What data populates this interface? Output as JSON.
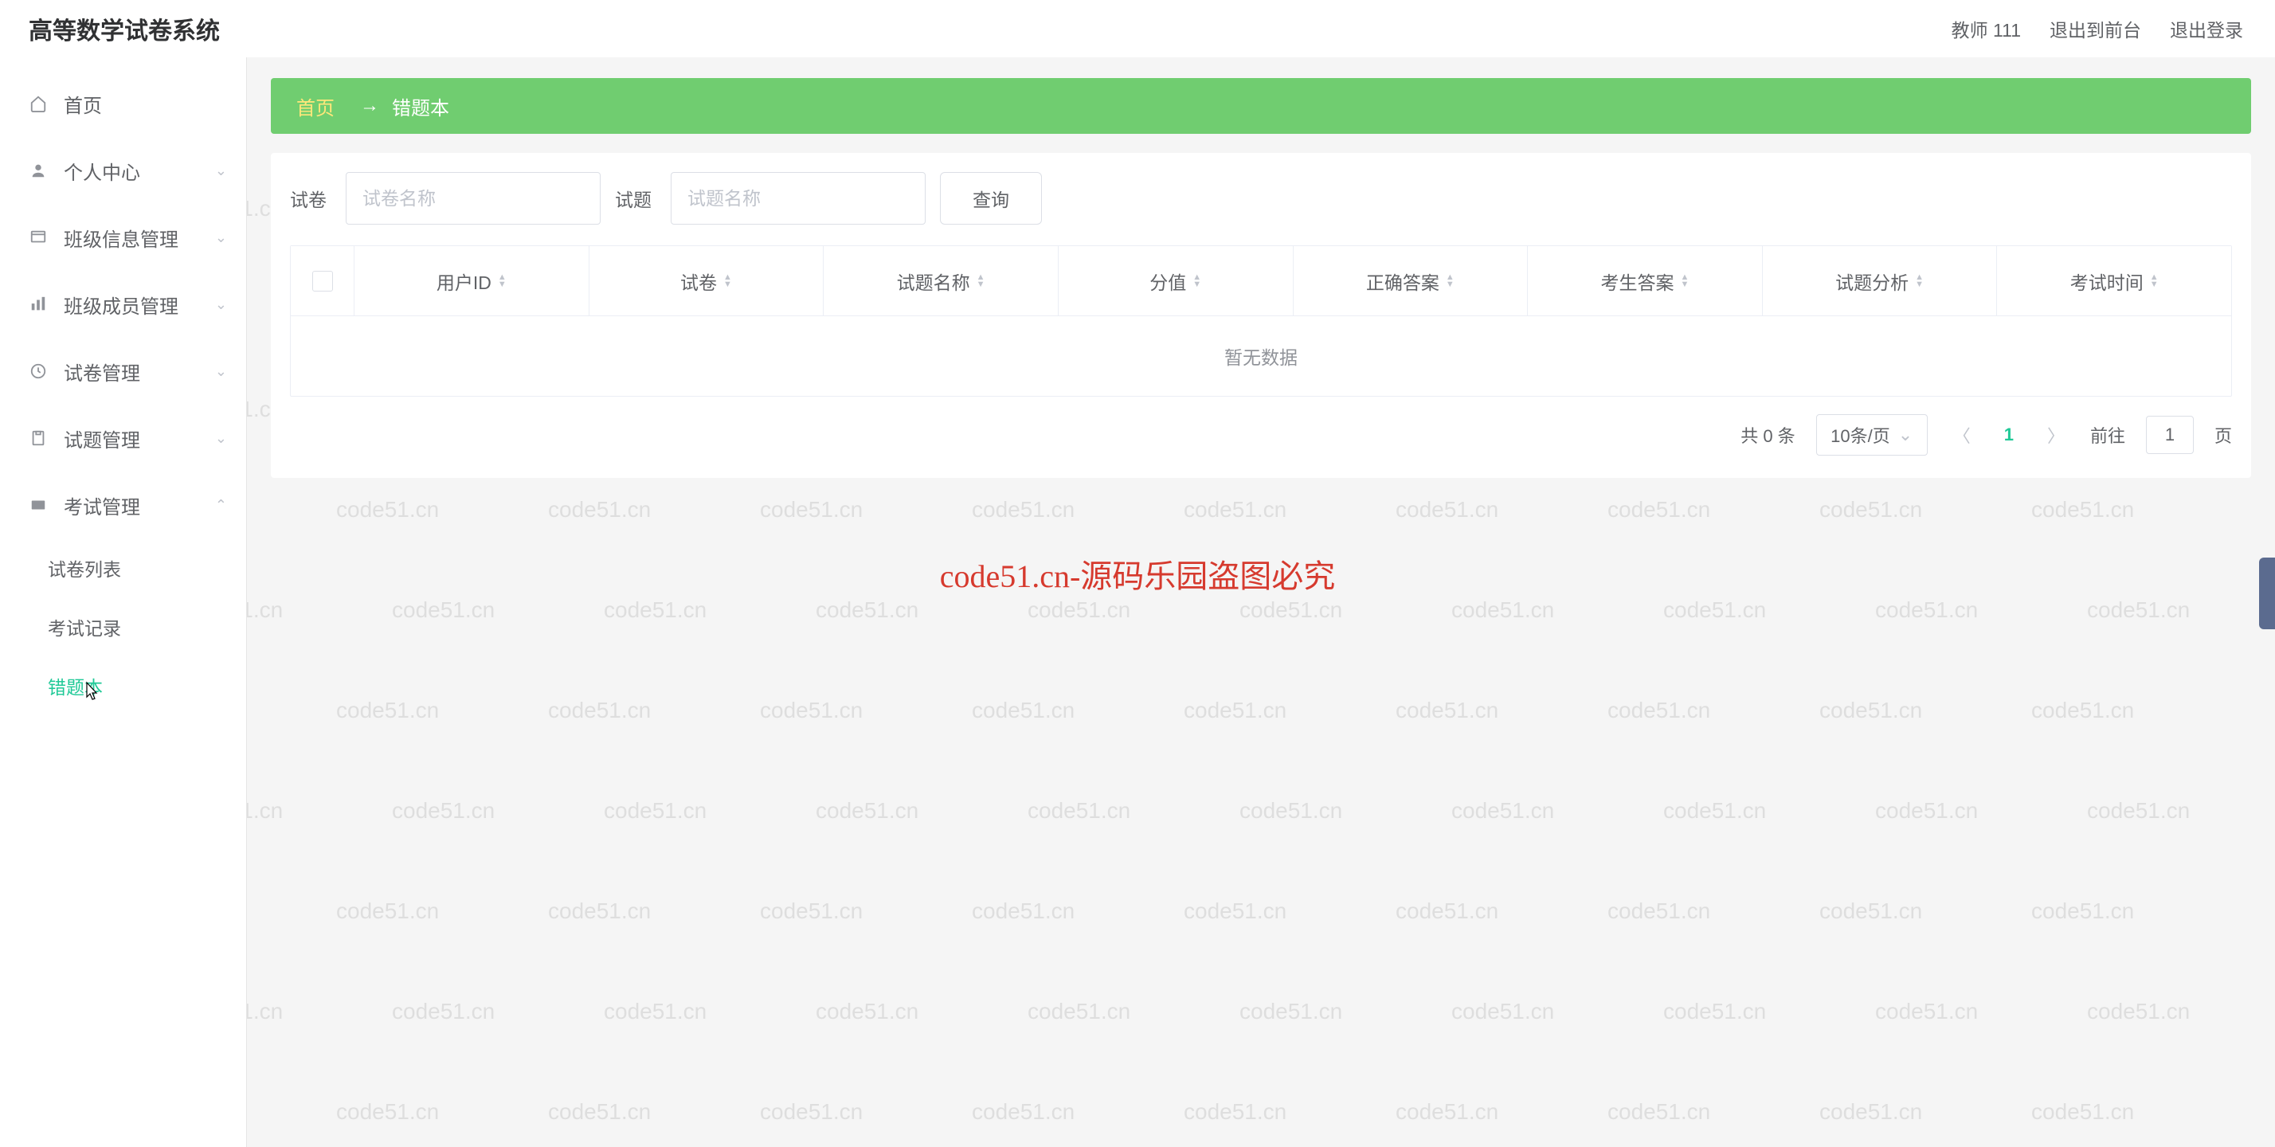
{
  "header": {
    "logo": "高等数学试卷系统",
    "user": "教师 111",
    "exit_front": "退出到前台",
    "logout": "退出登录"
  },
  "sidebar": {
    "home": "首页",
    "personal": "个人中心",
    "class_info": "班级信息管理",
    "class_member": "班级成员管理",
    "paper_mgmt": "试卷管理",
    "question_mgmt": "试题管理",
    "exam_mgmt": "考试管理",
    "sub_paper_list": "试卷列表",
    "sub_exam_record": "考试记录",
    "sub_wrong_book": "错题本"
  },
  "breadcrumb": {
    "home": "首页",
    "sep": "→",
    "current": "错题本"
  },
  "filter": {
    "paper_label": "试卷",
    "paper_placeholder": "试卷名称",
    "question_label": "试题",
    "question_placeholder": "试题名称",
    "query_btn": "查询"
  },
  "table": {
    "cols": {
      "user_id": "用户ID",
      "paper": "试卷",
      "question_name": "试题名称",
      "score": "分值",
      "correct_answer": "正确答案",
      "stu_answer": "考生答案",
      "analysis": "试题分析",
      "exam_time": "考试时间"
    },
    "empty": "暂无数据"
  },
  "pagination": {
    "total": "共 0 条",
    "page_size": "10条/页",
    "current": "1",
    "jump_label": "前往",
    "jump_value": "1",
    "jump_suffix": "页"
  },
  "watermark": {
    "text": "code51.cn",
    "center": "code51.cn-源码乐园盗图必究"
  }
}
